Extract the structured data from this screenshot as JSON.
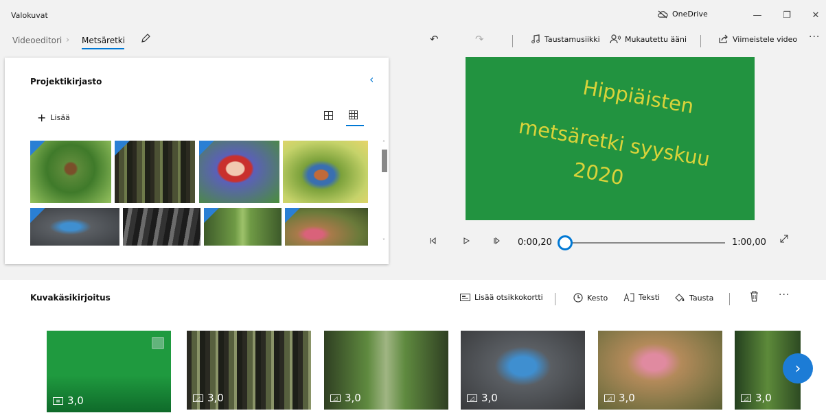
{
  "window": {
    "app_title": "Valokuvat",
    "onedrive_label": "OneDrive",
    "minimize": "—",
    "restore": "❐",
    "close": "✕"
  },
  "nav": {
    "crumb_root": "Videoeditori",
    "crumb_separator": "›",
    "crumb_current": "Metsäretki",
    "edit_icon": "pencil-icon"
  },
  "toolbar": {
    "undo": "↶",
    "redo": "↷",
    "music_label": "Taustamusiikki",
    "voice_label": "Mukautettu ääni",
    "finish_label": "Viimeistele video",
    "more": "···"
  },
  "library": {
    "title": "Projektikirjasto",
    "add_label": "Lisää",
    "collapse": "‹"
  },
  "preview": {
    "lines": [
      "Hippiäisten",
      "metsäretki syyskuu",
      "2020"
    ],
    "bg_color": "#229340",
    "text_color": "#d9d33a"
  },
  "playback": {
    "current_time": "0:00,20",
    "total_time": "1:00,00",
    "progress": 0.003
  },
  "storyboard": {
    "title": "Kuvakäsikirjoitus",
    "add_titlecard_label": "Lisää otsikkokortti",
    "duration_label": "Kesto",
    "text_label": "Teksti",
    "background_label": "Tausta",
    "more": "···",
    "clips": [
      {
        "duration": "3,0"
      },
      {
        "duration": "3,0"
      },
      {
        "duration": "3,0"
      },
      {
        "duration": "3,0"
      },
      {
        "duration": "3,0"
      },
      {
        "duration": "3,0"
      }
    ]
  }
}
